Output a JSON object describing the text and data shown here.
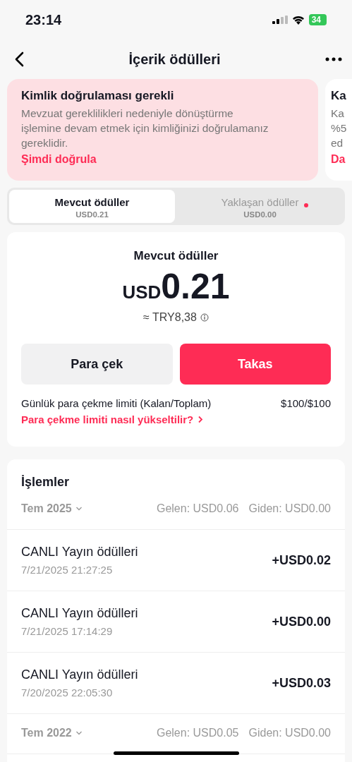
{
  "status_bar": {
    "time": "23:14",
    "battery": "34"
  },
  "header": {
    "title": "İçerik ödülleri"
  },
  "banners": [
    {
      "title": "Kimlik doğrulaması gerekli",
      "body": "Mevzuat gereklilikleri nedeniyle dönüştürme işlemine devam etmek için kimliğinizi doğrulamanız gereklidir.",
      "link": "Şimdi doğrula",
      "kind": "alert"
    },
    {
      "title": "Ka",
      "body_lines": [
        "Ka",
        "%5",
        "ed"
      ],
      "link": "Da",
      "kind": "partial"
    }
  ],
  "tabs": [
    {
      "label": "Mevcut ödüller",
      "amount": "USD0.21",
      "selected": true,
      "dot": false
    },
    {
      "label": "Yaklaşan ödüller",
      "amount": "USD0.00",
      "selected": false,
      "dot": true
    }
  ],
  "balance": {
    "title": "Mevcut ödüller",
    "currency": "USD",
    "amount": "0.21",
    "converted": "≈ TRY8,38",
    "buttons": [
      {
        "label": "Para çek",
        "kind": "secondary"
      },
      {
        "label": "Takas",
        "kind": "primary"
      }
    ],
    "limit_label": "Günlük para çekme limiti (Kalan/Toplam)",
    "limit_value": "$100/$100",
    "limit_link": "Para çekme limiti nasıl yükseltilir?"
  },
  "transactions": {
    "title": "İşlemler",
    "groups": [
      {
        "month": "Tem 2025",
        "incoming": "Gelen: USD0.06",
        "outgoing": "Giden: USD0.00",
        "rows": [
          {
            "name": "CANLI Yayın ödülleri",
            "date": "7/21/2025 21:27:25",
            "amount": "+USD0.02"
          },
          {
            "name": "CANLI Yayın ödülleri",
            "date": "7/21/2025 17:14:29",
            "amount": "+USD0.00"
          },
          {
            "name": "CANLI Yayın ödülleri",
            "date": "7/20/2025 22:05:30",
            "amount": "+USD0.03"
          }
        ]
      },
      {
        "month": "Tem 2022",
        "incoming": "Gelen: USD0.05",
        "outgoing": "Giden: USD0.00"
      }
    ]
  }
}
